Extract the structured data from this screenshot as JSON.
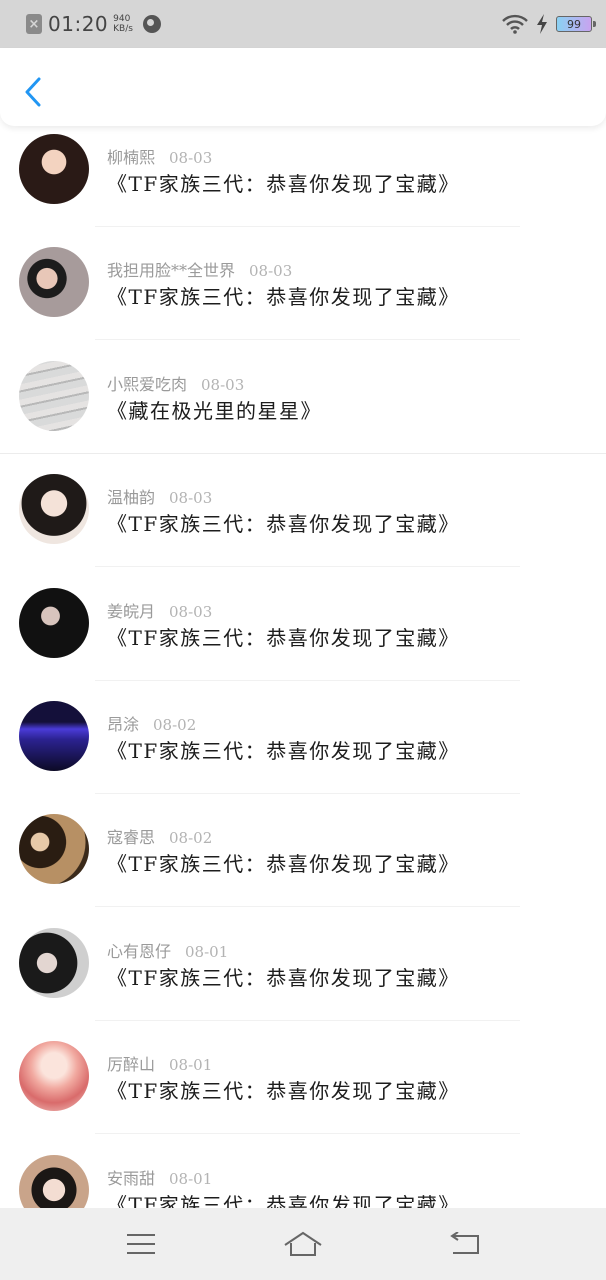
{
  "status_bar": {
    "time": "01:20",
    "net_speed_value": "940",
    "net_speed_unit": "KB/s",
    "battery": "99",
    "icons": [
      "close-notification-icon",
      "globe-icon",
      "wifi-icon",
      "charging-icon",
      "battery-icon"
    ]
  },
  "header": {
    "back_icon": "chevron-left-icon",
    "accent_color": "#2196f3"
  },
  "comments": [
    {
      "name": "柳楠熙",
      "date": "08-03",
      "title": "《TF家族三代：恭喜你发现了宝藏》"
    },
    {
      "name": "我担用脸**全世界",
      "date": "08-03",
      "title": "《TF家族三代：恭喜你发现了宝藏》"
    },
    {
      "name": "小熙爱吃肉",
      "date": "08-03",
      "title": "《藏在极光里的星星》"
    },
    {
      "name": "温柚韵",
      "date": "08-03",
      "title": "《TF家族三代：恭喜你发现了宝藏》"
    },
    {
      "name": "姜皖月",
      "date": "08-03",
      "title": "《TF家族三代：恭喜你发现了宝藏》"
    },
    {
      "name": "昂涂",
      "date": "08-02",
      "title": "《TF家族三代：恭喜你发现了宝藏》"
    },
    {
      "name": "寇睿思",
      "date": "08-02",
      "title": "《TF家族三代：恭喜你发现了宝藏》"
    },
    {
      "name": "心有恩仔",
      "date": "08-01",
      "title": "《TF家族三代：恭喜你发现了宝藏》"
    },
    {
      "name": "厉醉山",
      "date": "08-01",
      "title": "《TF家族三代：恭喜你发现了宝藏》"
    },
    {
      "name": "安雨甜",
      "date": "08-01",
      "title": "《TF家族三代：恭喜你发现了宝藏》"
    }
  ],
  "nav_bar": {
    "icons": [
      "menu-icon",
      "home-icon",
      "back-icon"
    ]
  }
}
